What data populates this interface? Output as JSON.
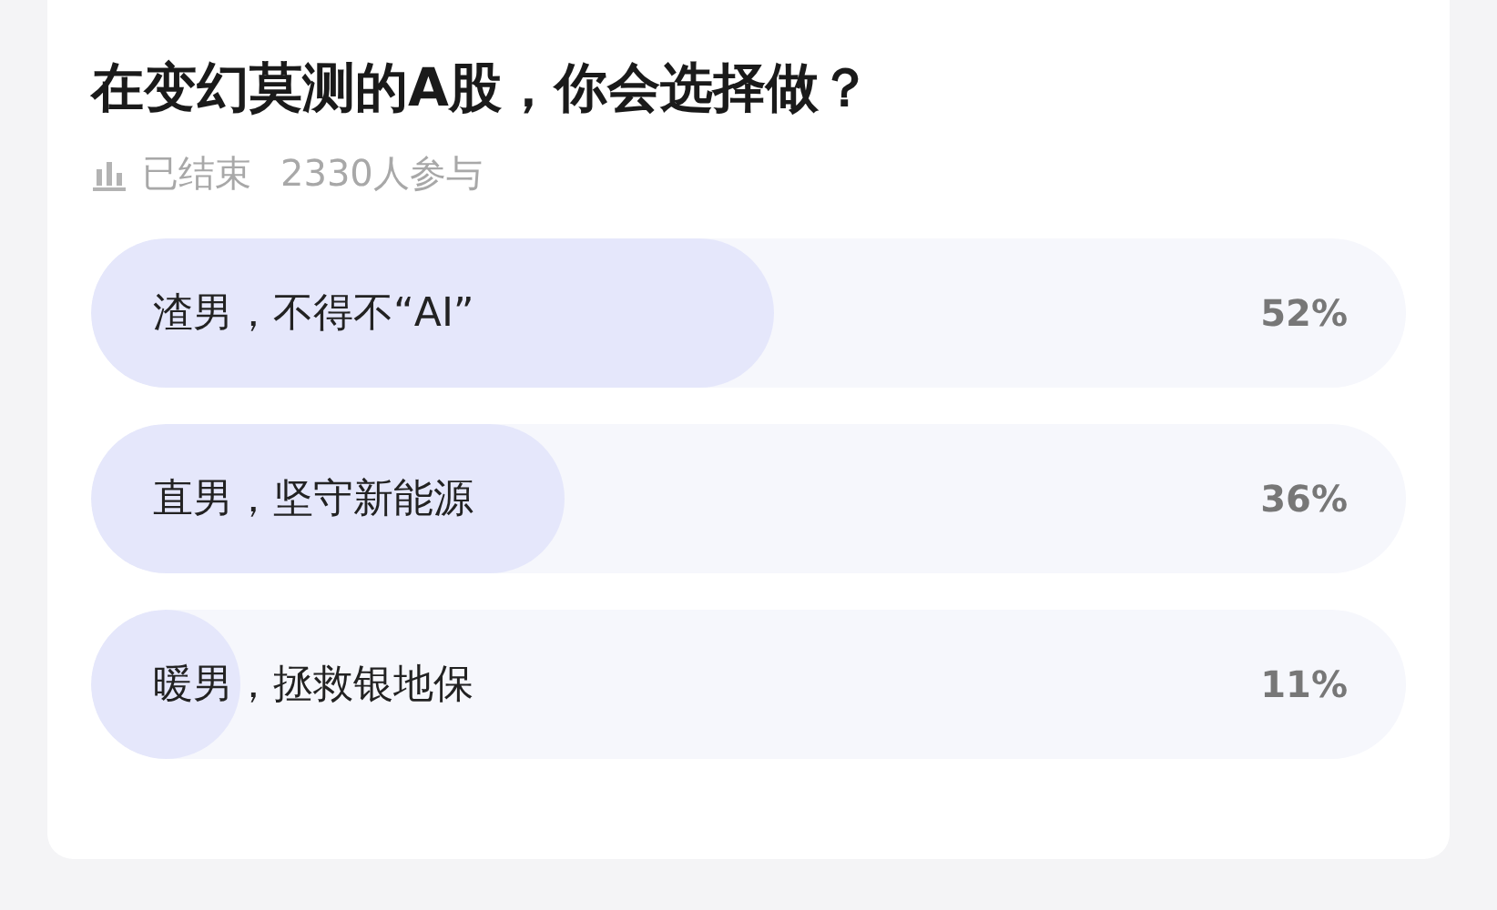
{
  "poll": {
    "title": "在变幻莫测的A股，你会选择做？",
    "status": "已结束",
    "participants": "2330人参与",
    "options": [
      {
        "label": "渣男，不得不“AI”",
        "level": 0.52,
        "percent": "52%"
      },
      {
        "label": "直男，坚守新能源",
        "level": 0.36,
        "percent": "36%"
      },
      {
        "label": "暖男，拯救银地保",
        "level": 0.11,
        "percent": "11%"
      }
    ]
  }
}
